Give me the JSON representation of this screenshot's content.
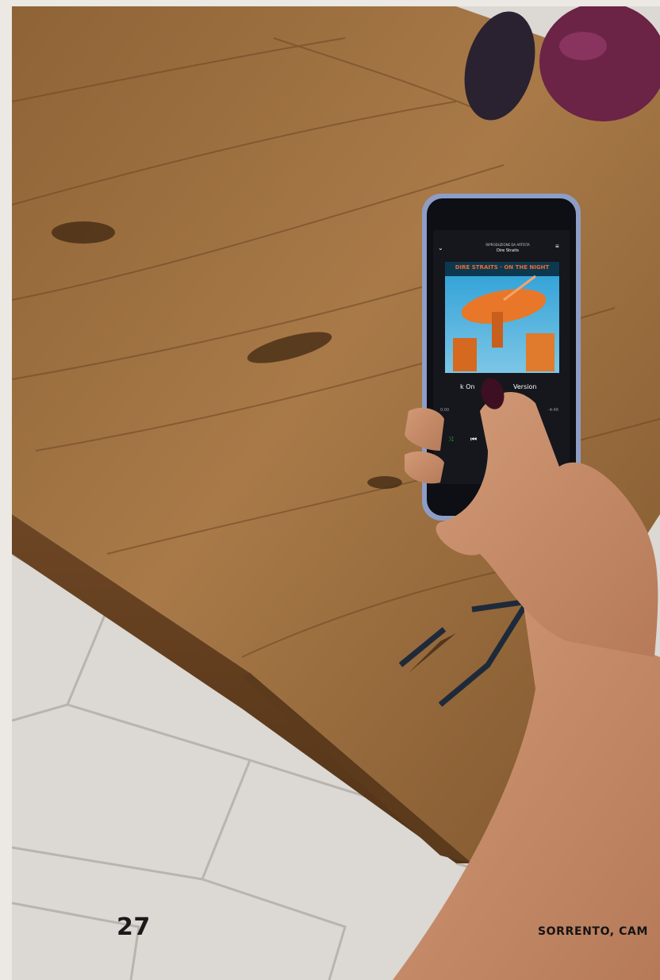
{
  "page": {
    "page_number": "27",
    "location_caption": "SORRENTO, CAM"
  },
  "phone_screen": {
    "header_small": "RIPRODUZIONE DA ARTISTA",
    "header_artist": "Dire Straits",
    "album_banner": "DIRE STRAITS · ON THE NIGHT",
    "track_title": "k On",
    "track_suffix": "Version",
    "time_elapsed": "0:00",
    "time_remaining": "-4:46"
  },
  "colors": {
    "page_background": "#ece8e3",
    "wood": "#9a6a3c",
    "floor": "#dcd8d3",
    "phone_body": "#8d9dc6",
    "album_orange": "#e8772a",
    "accent_green": "#1db954"
  }
}
